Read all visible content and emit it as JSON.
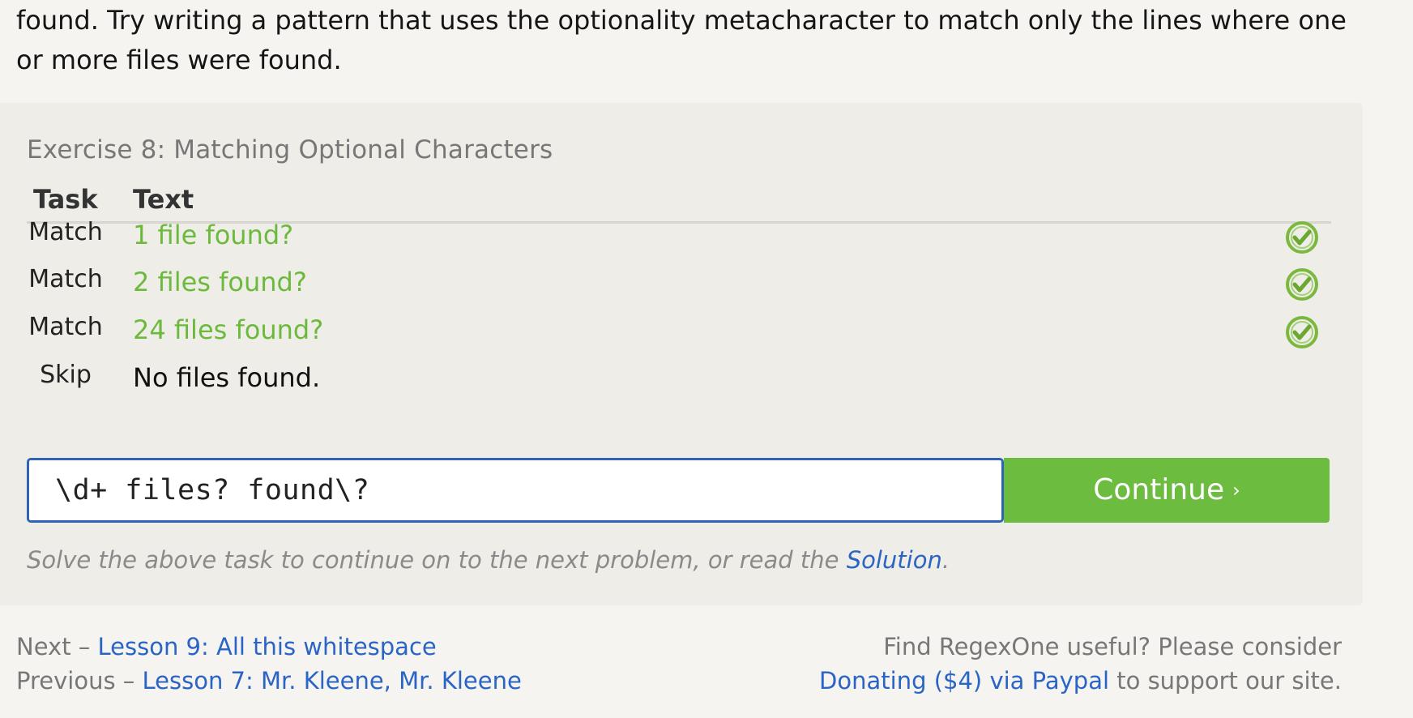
{
  "intro": {
    "line1": "found. Try writing a pattern that uses the optionality metacharacter to match only the lines where one",
    "line2": "or more files were found."
  },
  "exercise": {
    "title": "Exercise 8: Matching Optional Characters",
    "headers": {
      "task": "Task",
      "text": "Text"
    },
    "rows": [
      {
        "task": "Match",
        "text": "1 file found?",
        "status": "matched"
      },
      {
        "task": "Match",
        "text": "2 files found?",
        "status": "matched"
      },
      {
        "task": "Match",
        "text": "24 files found?",
        "status": "matched"
      },
      {
        "task": "Skip",
        "text": "No files found.",
        "status": "none"
      }
    ],
    "input_value": "\\d+ files? found\\?",
    "continue_label": "Continue",
    "hint_prefix": "Solve the above task to continue on to the next problem, or read the ",
    "hint_link": "Solution",
    "hint_suffix": "."
  },
  "footer": {
    "next_label": "Next",
    "next_link": "Lesson 9: All this whitespace",
    "prev_label": "Previous",
    "prev_link": "Lesson 7: Mr. Kleene, Mr. Kleene",
    "donate_line1": "Find RegexOne useful? Please consider",
    "donate_link": "Donating ($4) via Paypal",
    "donate_suffix": "to support our site."
  },
  "colors": {
    "match_text": "#6cba3c",
    "accent_blue": "#2a64c5",
    "button_green": "#6cbd3f"
  }
}
